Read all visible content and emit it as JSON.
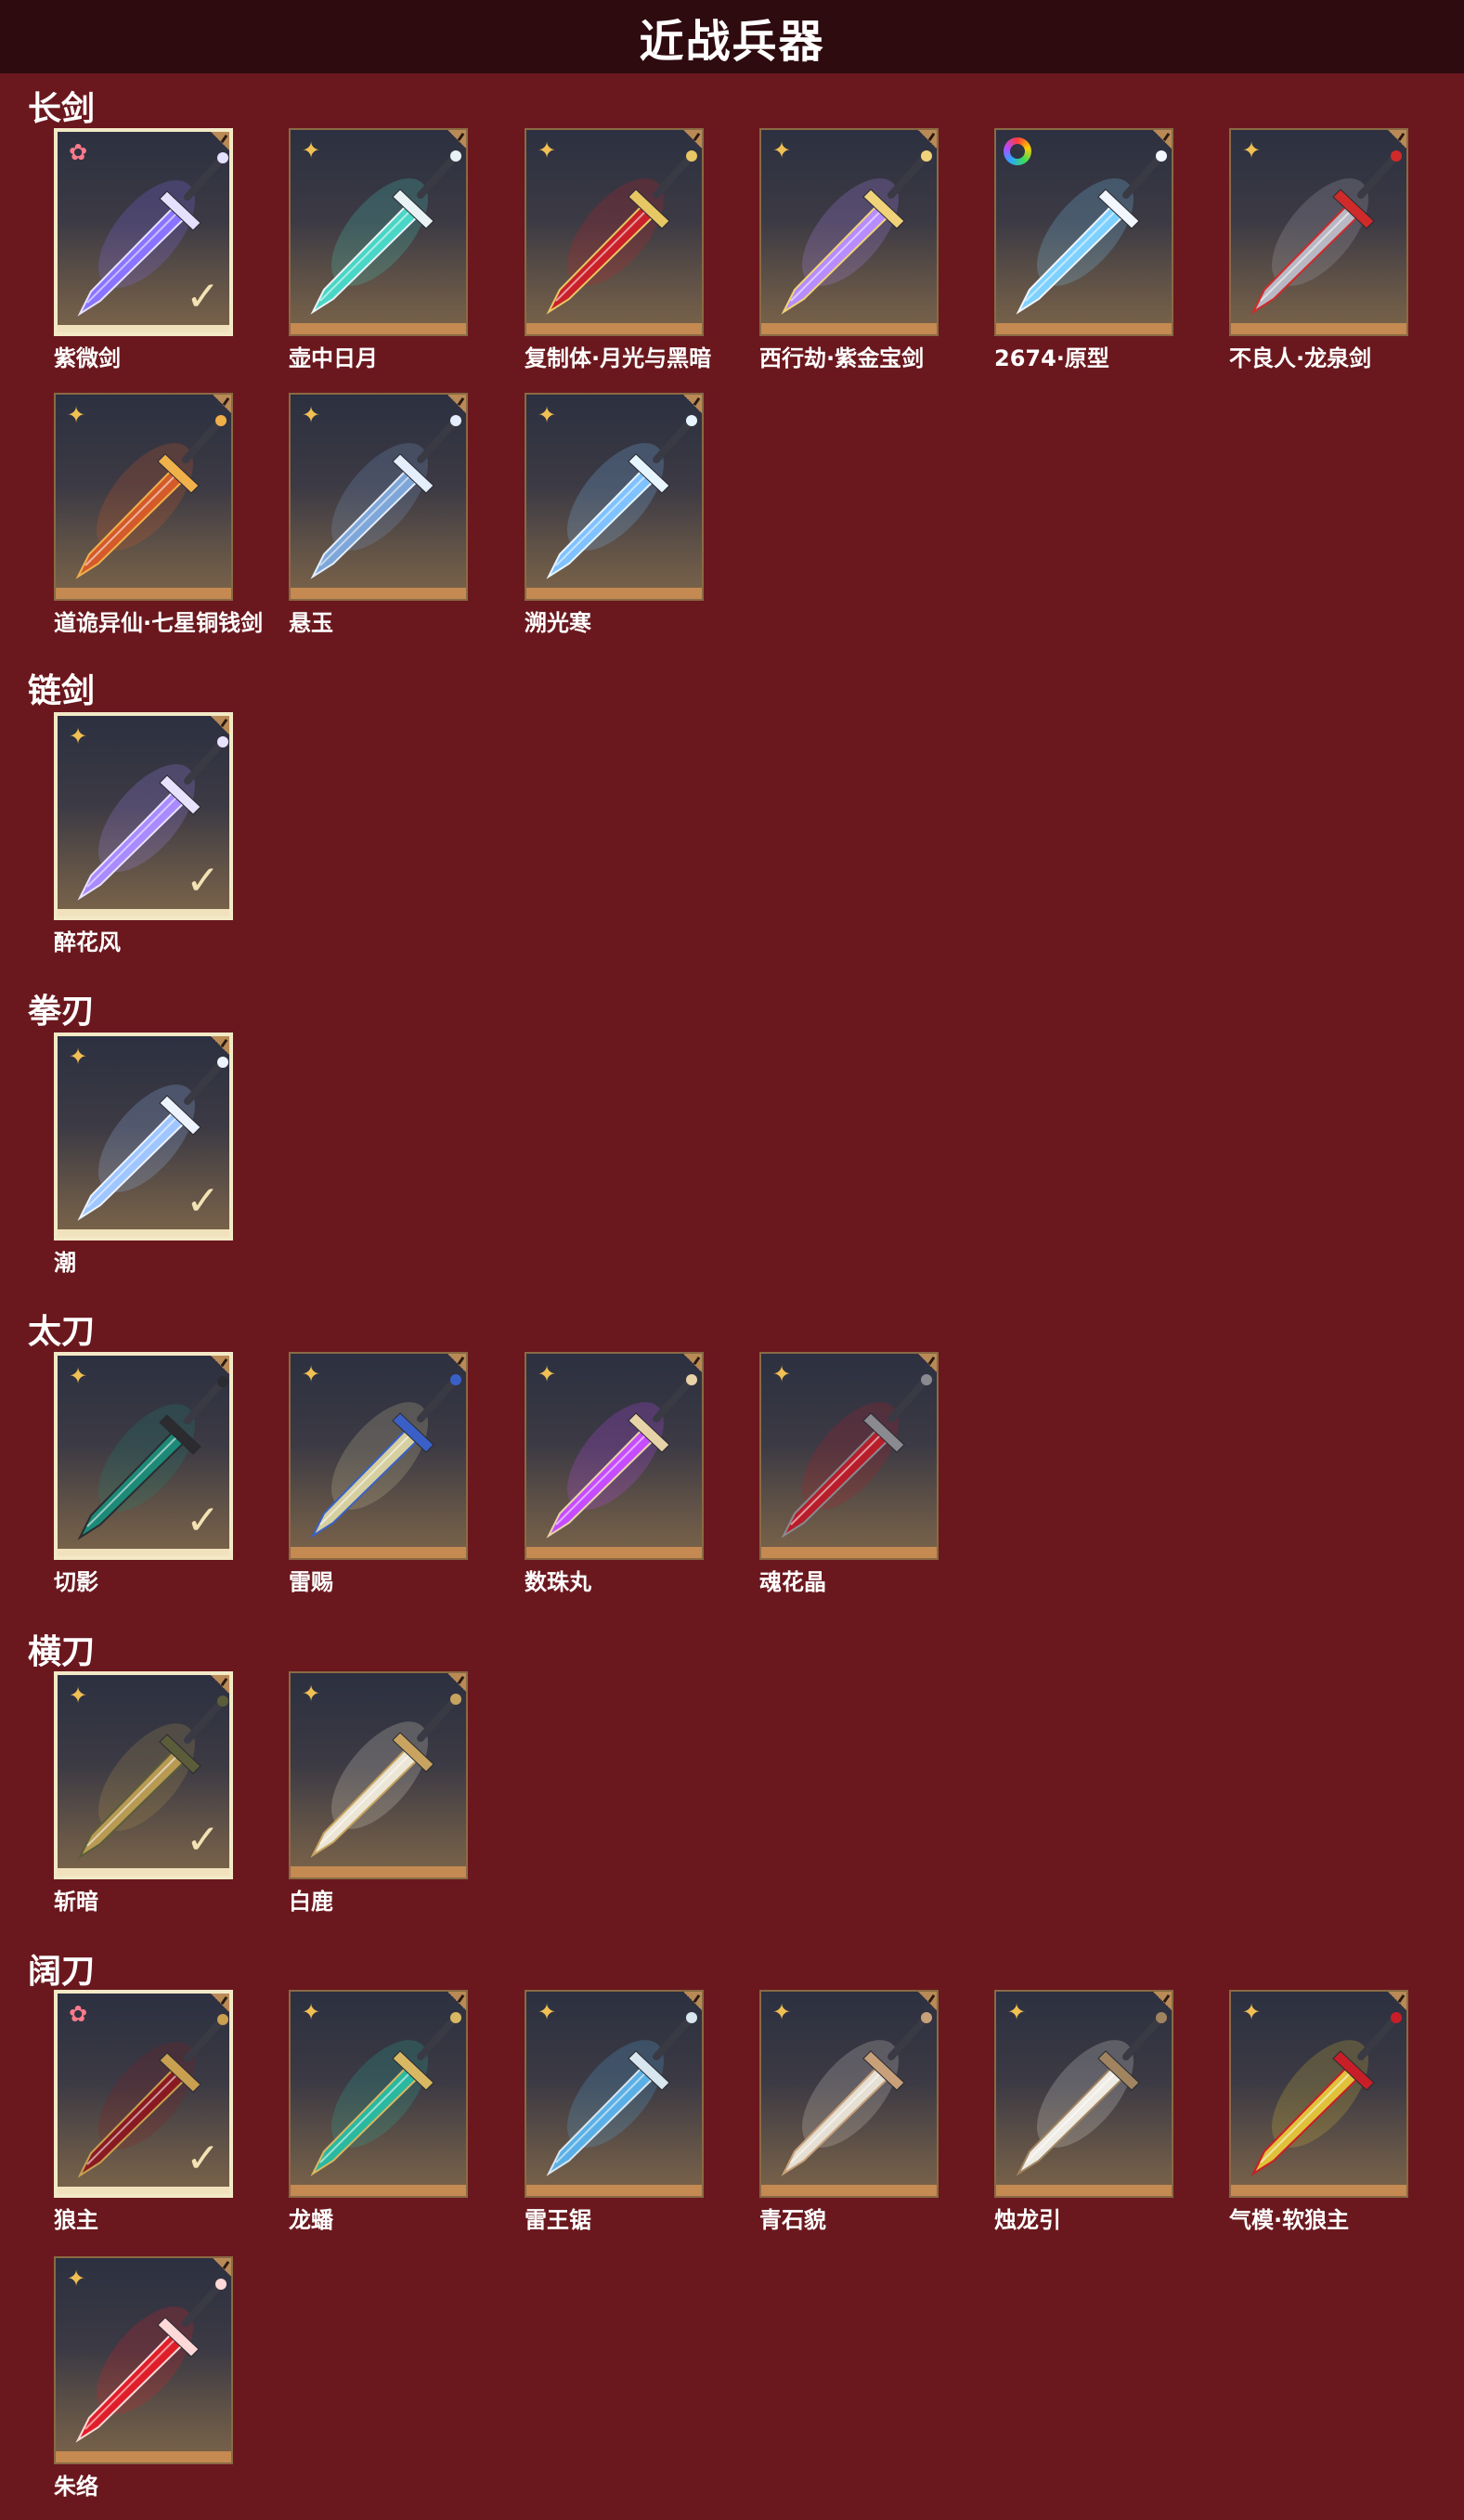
{
  "page": {
    "title": "近战兵器"
  },
  "categories": [
    {
      "name": "长剑",
      "items": [
        {
          "name": "紫微剑",
          "rank": "red",
          "selected": true,
          "blade": "#8a74ff",
          "accent": "#e6e0ff"
        },
        {
          "name": "壶中日月",
          "rank": "gold",
          "selected": false,
          "blade": "#49d6c6",
          "accent": "#e9f3f5"
        },
        {
          "name": "复制体·月光与黑暗",
          "rank": "gold",
          "selected": false,
          "blade": "#c9202a",
          "accent": "#e7c764"
        },
        {
          "name": "西行劫·紫金宝剑",
          "rank": "gold",
          "selected": false,
          "blade": "#b68cff",
          "accent": "#f0d27a"
        },
        {
          "name": "2674·原型",
          "rank": "rainbow",
          "selected": false,
          "blade": "#7ed1ff",
          "accent": "#f2f6ff"
        },
        {
          "name": "不良人·龙泉剑",
          "rank": "gold",
          "selected": false,
          "blade": "#b8b8c4",
          "accent": "#d02a2a"
        },
        {
          "name": "道诡异仙·七星铜钱剑",
          "rank": "gold",
          "selected": false,
          "blade": "#d45a2a",
          "accent": "#f0b04a"
        },
        {
          "name": "悬玉",
          "rank": "gold",
          "selected": false,
          "blade": "#7fa6d8",
          "accent": "#e4eefc"
        },
        {
          "name": "溯光寒",
          "rank": "gold",
          "selected": false,
          "blade": "#7fc2ff",
          "accent": "#e6f5ff"
        }
      ]
    },
    {
      "name": "链剑",
      "items": [
        {
          "name": "醉花风",
          "rank": "gold",
          "selected": true,
          "blade": "#a98bff",
          "accent": "#e9e2ff"
        }
      ]
    },
    {
      "name": "拳刃",
      "items": [
        {
          "name": "潮",
          "rank": "gold",
          "selected": true,
          "blade": "#9fc6ff",
          "accent": "#eef4ff"
        }
      ]
    },
    {
      "name": "太刀",
      "items": [
        {
          "name": "切影",
          "rank": "gold",
          "selected": true,
          "blade": "#1d8a78",
          "accent": "#2b2b30"
        },
        {
          "name": "雷赐",
          "rank": "gold",
          "selected": false,
          "blade": "#d6cfa0",
          "accent": "#3a60c8"
        },
        {
          "name": "数珠丸",
          "rank": "gold",
          "selected": false,
          "blade": "#c64cff",
          "accent": "#e8d3a8"
        },
        {
          "name": "魂花晶",
          "rank": "gold",
          "selected": false,
          "blade": "#b81d2a",
          "accent": "#8a8a90"
        }
      ]
    },
    {
      "name": "横刀",
      "items": [
        {
          "name": "斩暗",
          "rank": "gold",
          "selected": true,
          "blade": "#b89a52",
          "accent": "#5a5c3a"
        },
        {
          "name": "白鹿",
          "rank": "gold",
          "selected": false,
          "blade": "#ece6d6",
          "accent": "#c8a460"
        }
      ]
    },
    {
      "name": "阔刀",
      "items": [
        {
          "name": "狼主",
          "rank": "red",
          "selected": true,
          "blade": "#8a1a22",
          "accent": "#c8a050"
        },
        {
          "name": "龙蟠",
          "rank": "gold",
          "selected": false,
          "blade": "#2ab8a0",
          "accent": "#d8b862"
        },
        {
          "name": "雷王锯",
          "rank": "gold",
          "selected": false,
          "blade": "#5ab0e6",
          "accent": "#d8e6f0"
        },
        {
          "name": "青石貌",
          "rank": "gold",
          "selected": false,
          "blade": "#e6e0d4",
          "accent": "#c8a07a"
        },
        {
          "name": "烛龙引",
          "rank": "gold",
          "selected": false,
          "blade": "#efece6",
          "accent": "#a08460"
        },
        {
          "name": "气模·软狼主",
          "rank": "gold",
          "selected": false,
          "blade": "#e0c23a",
          "accent": "#c81e28"
        },
        {
          "name": "朱络",
          "rank": "gold",
          "selected": false,
          "blade": "#e01e2a",
          "accent": "#ffd8d8"
        }
      ]
    }
  ],
  "icons": {
    "rank_gold": "four-point-star-icon",
    "rank_red": "flower-icon",
    "rank_rainbow": "rainbow-ring-icon",
    "selected": "checkmark-icon",
    "corner": "corner-tab-icon"
  },
  "glyphs": {
    "rank_gold": "✦",
    "rank_red": "✿",
    "check": "✓"
  }
}
